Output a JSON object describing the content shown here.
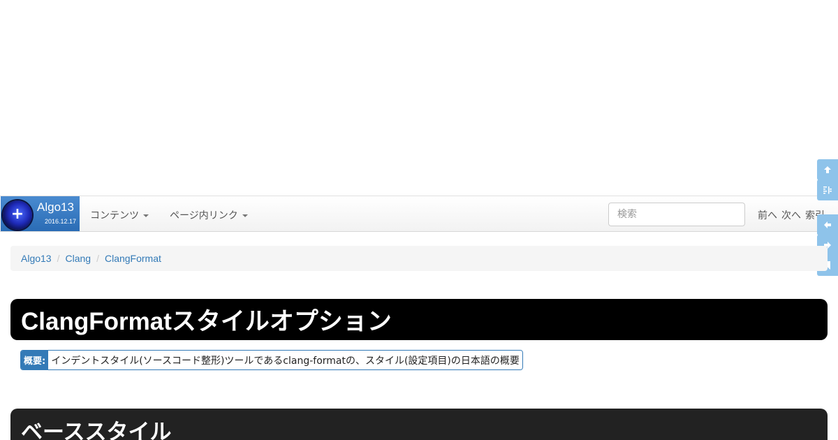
{
  "brand": {
    "title": "Algo13",
    "date": "2016.12.17"
  },
  "nav": {
    "contents_label": "コンテンツ",
    "page_links_label": "ページ内リンク",
    "search_placeholder": "検索",
    "prev_label": "前へ",
    "next_label": "次へ",
    "index_label": "索引"
  },
  "side_buttons": [
    {
      "icon": "arrow-up-icon"
    },
    {
      "icon": "toc-icon"
    },
    {
      "icon": "arrow-left-icon"
    },
    {
      "icon": "arrow-right-icon"
    },
    {
      "icon": "bookmark-icon"
    }
  ],
  "breadcrumb": [
    "Algo13",
    "Clang",
    "ClangFormat"
  ],
  "page_title": "ClangFormatスタイルオプション",
  "summary": {
    "label": "概要:",
    "text": "インデントスタイル(ソースコード整形)ツールであるclang-formatの、スタイル(設定項目)の日本語の概要"
  },
  "section_title": "ベーススタイル",
  "colors": {
    "brand": "#337ab7",
    "side_button": "#8ec3ea",
    "title_bg": "#000000"
  }
}
